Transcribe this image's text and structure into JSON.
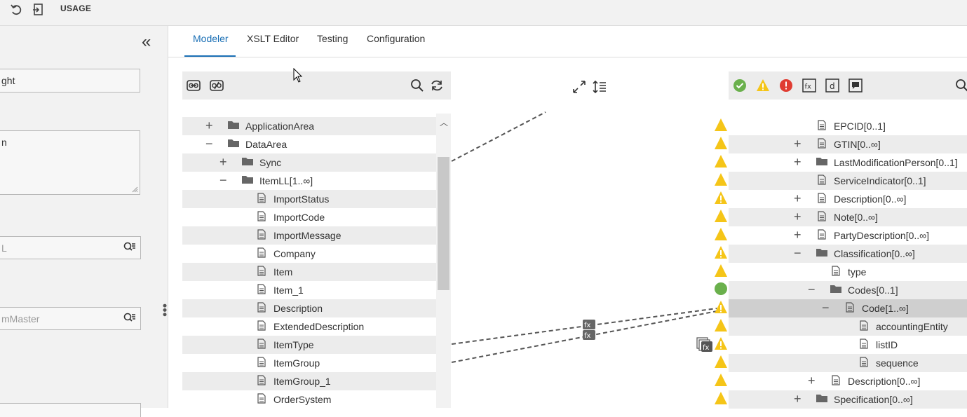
{
  "topbar": {
    "usage_label": "USAGE",
    "undo_icon": "undo-icon",
    "export_icon": "export-icon"
  },
  "left_panel": {
    "field1_value": "ght",
    "field2_value": "n",
    "field3_placeholder": "L",
    "field4_placeholder": "mMaster",
    "collapse_icon": "double-chevron-left-icon"
  },
  "tabs": [
    {
      "label": "Modeler",
      "active": true
    },
    {
      "label": "XSLT Editor",
      "active": false
    },
    {
      "label": "Testing",
      "active": false
    },
    {
      "label": "Configuration",
      "active": false
    }
  ],
  "source_tree": [
    {
      "label": "ApplicationArea",
      "type": "folder",
      "expander": "+"
    },
    {
      "label": "DataArea",
      "type": "folder",
      "expander": "−"
    },
    {
      "label": "Sync",
      "type": "folder",
      "expander": "+"
    },
    {
      "label": "ItemLL[1..∞]",
      "type": "folder",
      "expander": "−"
    },
    {
      "label": "ImportStatus",
      "type": "doc"
    },
    {
      "label": "ImportCode",
      "type": "doc"
    },
    {
      "label": "ImportMessage",
      "type": "doc"
    },
    {
      "label": "Company",
      "type": "doc"
    },
    {
      "label": "Item",
      "type": "doc"
    },
    {
      "label": "Item_1",
      "type": "doc"
    },
    {
      "label": "Description",
      "type": "doc"
    },
    {
      "label": "ExtendedDescription",
      "type": "doc"
    },
    {
      "label": "ItemType",
      "type": "doc"
    },
    {
      "label": "ItemGroup",
      "type": "doc"
    },
    {
      "label": "ItemGroup_1",
      "type": "doc"
    },
    {
      "label": "OrderSystem",
      "type": "doc"
    }
  ],
  "target_tree": [
    {
      "label": "EPCID[0..1]",
      "type": "doc",
      "marker": "warning"
    },
    {
      "label": "GTIN[0..∞]",
      "type": "doc",
      "expander": "+",
      "marker": "warning"
    },
    {
      "label": "LastModificationPerson[0..1]",
      "type": "folder",
      "expander": "+",
      "marker": "warning"
    },
    {
      "label": "ServiceIndicator[0..1]",
      "type": "doc",
      "marker": "warning"
    },
    {
      "label": "Description[0..∞]",
      "type": "doc",
      "expander": "+",
      "marker": "warning-exclaim"
    },
    {
      "label": "Note[0..∞]",
      "type": "doc",
      "expander": "+",
      "marker": "warning"
    },
    {
      "label": "PartyDescription[0..∞]",
      "type": "doc",
      "expander": "+",
      "marker": "warning"
    },
    {
      "label": "Classification[0..∞]",
      "type": "folder",
      "expander": "−",
      "marker": "warning-exclaim"
    },
    {
      "label": "type",
      "type": "doc",
      "marker": "warning"
    },
    {
      "label": "Codes[0..1]",
      "type": "folder",
      "expander": "−",
      "marker": "ok"
    },
    {
      "label": "Code[1..∞]",
      "type": "doc",
      "expander": "−",
      "marker": "warning-exclaim",
      "selected": true
    },
    {
      "label": "accountingEntity",
      "type": "doc",
      "marker": "warning"
    },
    {
      "label": "listID",
      "type": "doc",
      "marker": "warning-exclaim"
    },
    {
      "label": "sequence",
      "type": "doc",
      "marker": "warning"
    },
    {
      "label": "Description[0..∞]",
      "type": "doc",
      "expander": "+",
      "marker": "warning"
    },
    {
      "label": "Specification[0..∞]",
      "type": "folder",
      "expander": "+",
      "marker": "warning"
    }
  ],
  "colors": {
    "accent": "#1a6fb5",
    "warning": "#f5c518",
    "ok": "#6ab04c",
    "error": "#e03c31"
  }
}
